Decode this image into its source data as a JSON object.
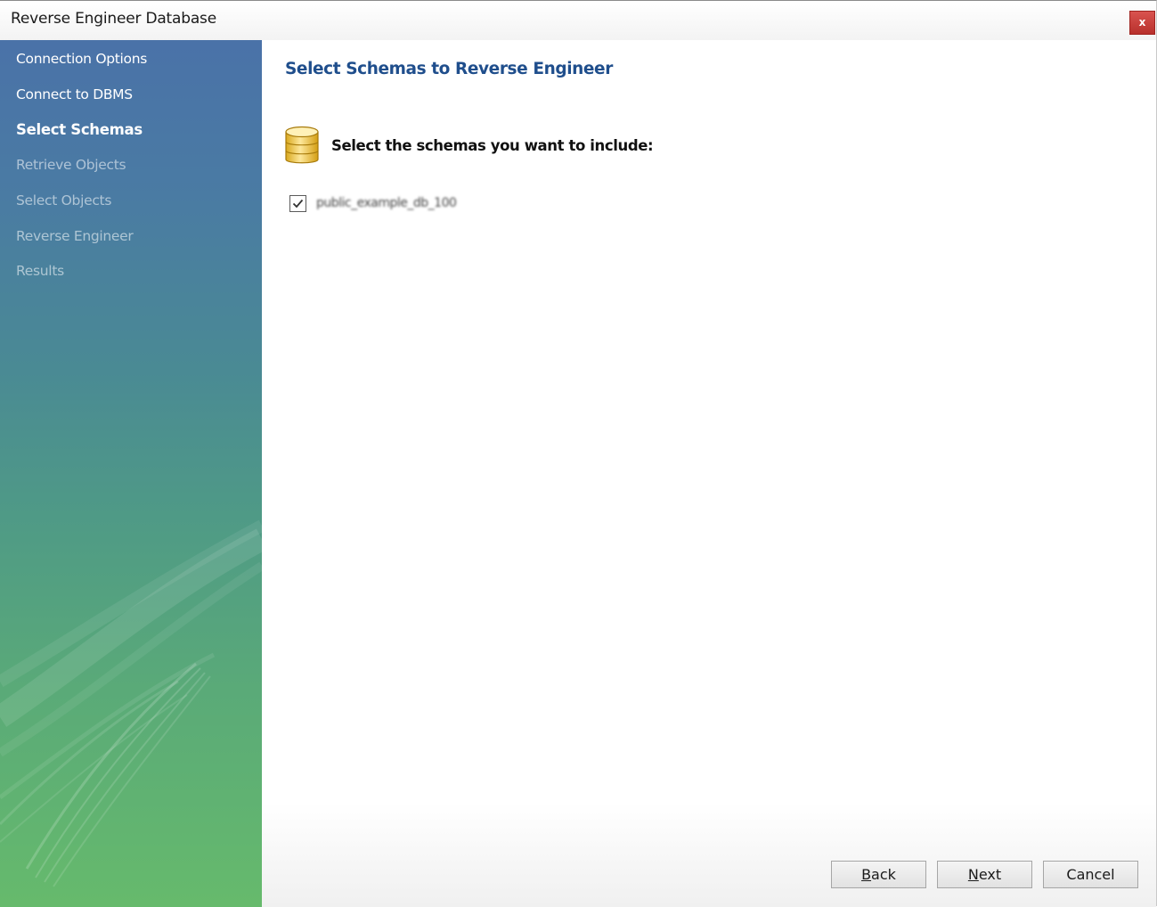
{
  "window": {
    "title": "Reverse Engineer Database",
    "close_label": "x"
  },
  "sidebar": {
    "items": [
      {
        "label": "Connection Options",
        "state": "done"
      },
      {
        "label": "Connect to DBMS",
        "state": "done"
      },
      {
        "label": "Select Schemas",
        "state": "active"
      },
      {
        "label": "Retrieve Objects",
        "state": "pending"
      },
      {
        "label": "Select Objects",
        "state": "pending"
      },
      {
        "label": "Reverse Engineer",
        "state": "pending"
      },
      {
        "label": "Results",
        "state": "pending"
      }
    ]
  },
  "main": {
    "title": "Select Schemas to Reverse Engineer",
    "instruction": "Select the schemas you want to include:",
    "icon": "database-icon",
    "schemas": [
      {
        "label": "public_example_db_100",
        "checked": true
      }
    ]
  },
  "footer": {
    "back": {
      "mnemonic": "B",
      "rest": "ack"
    },
    "next": {
      "mnemonic": "N",
      "rest": "ext"
    },
    "cancel": "Cancel"
  },
  "colors": {
    "title_accent": "#1f4e8c",
    "sidebar_top": "#4a72a8",
    "sidebar_bottom": "#66ba6c",
    "close_button": "#c9403c"
  }
}
